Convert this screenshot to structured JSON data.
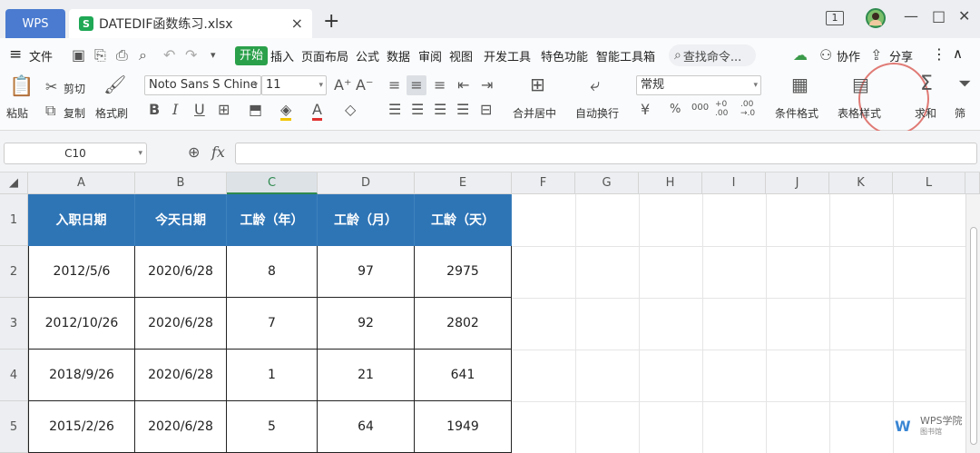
{
  "titlebar": {
    "app_tab": "WPS",
    "file_icon": "S",
    "file_name": "DATEDIF函数练习.xlsx",
    "close_glyph": "×",
    "new_tab_glyph": "+",
    "page_indicator": "1",
    "minimize_glyph": "—",
    "maximize_glyph": "□",
    "close_window_glyph": "✕"
  },
  "menu": {
    "hamburger": "≡",
    "file": "文件",
    "items": [
      "开始",
      "插入",
      "页面布局",
      "公式",
      "数据",
      "审阅",
      "视图",
      "开发工具",
      "特色功能",
      "智能工具箱"
    ],
    "search_placeholder": "查找命令...",
    "collaborate": "协作",
    "share": "分享",
    "more": "⋮",
    "collapse": "∧"
  },
  "toolbar": {
    "paste": "粘贴",
    "cut": "剪切",
    "copy": "复制",
    "format_painter": "格式刷",
    "font_name": "Noto Sans S Chine",
    "font_size": "11",
    "bold": "B",
    "italic": "I",
    "underline": "U",
    "merge_center": "合并居中",
    "wrap_text": "自动换行",
    "number_format": "常规",
    "currency": "¥",
    "percent": "%",
    "thousands": "000",
    "inc_decimal": "+0 .00",
    "dec_decimal": ".00 →.0",
    "conditional_format": "条件格式",
    "table_style": "表格样式",
    "sum": "求和",
    "filter": "筛"
  },
  "formula_bar": {
    "cell_ref": "C10",
    "fx": "fx",
    "formula": ""
  },
  "sheet": {
    "columns": [
      "A",
      "B",
      "C",
      "D",
      "E",
      "F",
      "G",
      "H",
      "I",
      "J",
      "K",
      "L"
    ],
    "selected_column": "C",
    "rows": [
      "1",
      "2",
      "3",
      "4",
      "5"
    ],
    "headers": [
      "入职日期",
      "今天日期",
      "工龄（年）",
      "工龄（月）",
      "工龄（天）"
    ],
    "data": [
      [
        "2012/5/6",
        "2020/6/28",
        "8",
        "97",
        "2975"
      ],
      [
        "2012/10/26",
        "2020/6/28",
        "7",
        "92",
        "2802"
      ],
      [
        "2018/9/26",
        "2020/6/28",
        "1",
        "21",
        "641"
      ],
      [
        "2015/2/26",
        "2020/6/28",
        "5",
        "64",
        "1949"
      ]
    ]
  },
  "watermark": {
    "title": "WPS学院",
    "subtitle": "图书馆"
  },
  "colors": {
    "header_fill": "#2e75b6",
    "accent_green": "#2aa04a",
    "wps_blue": "#4a7bd0",
    "annotation_circle": "#e07a75"
  }
}
